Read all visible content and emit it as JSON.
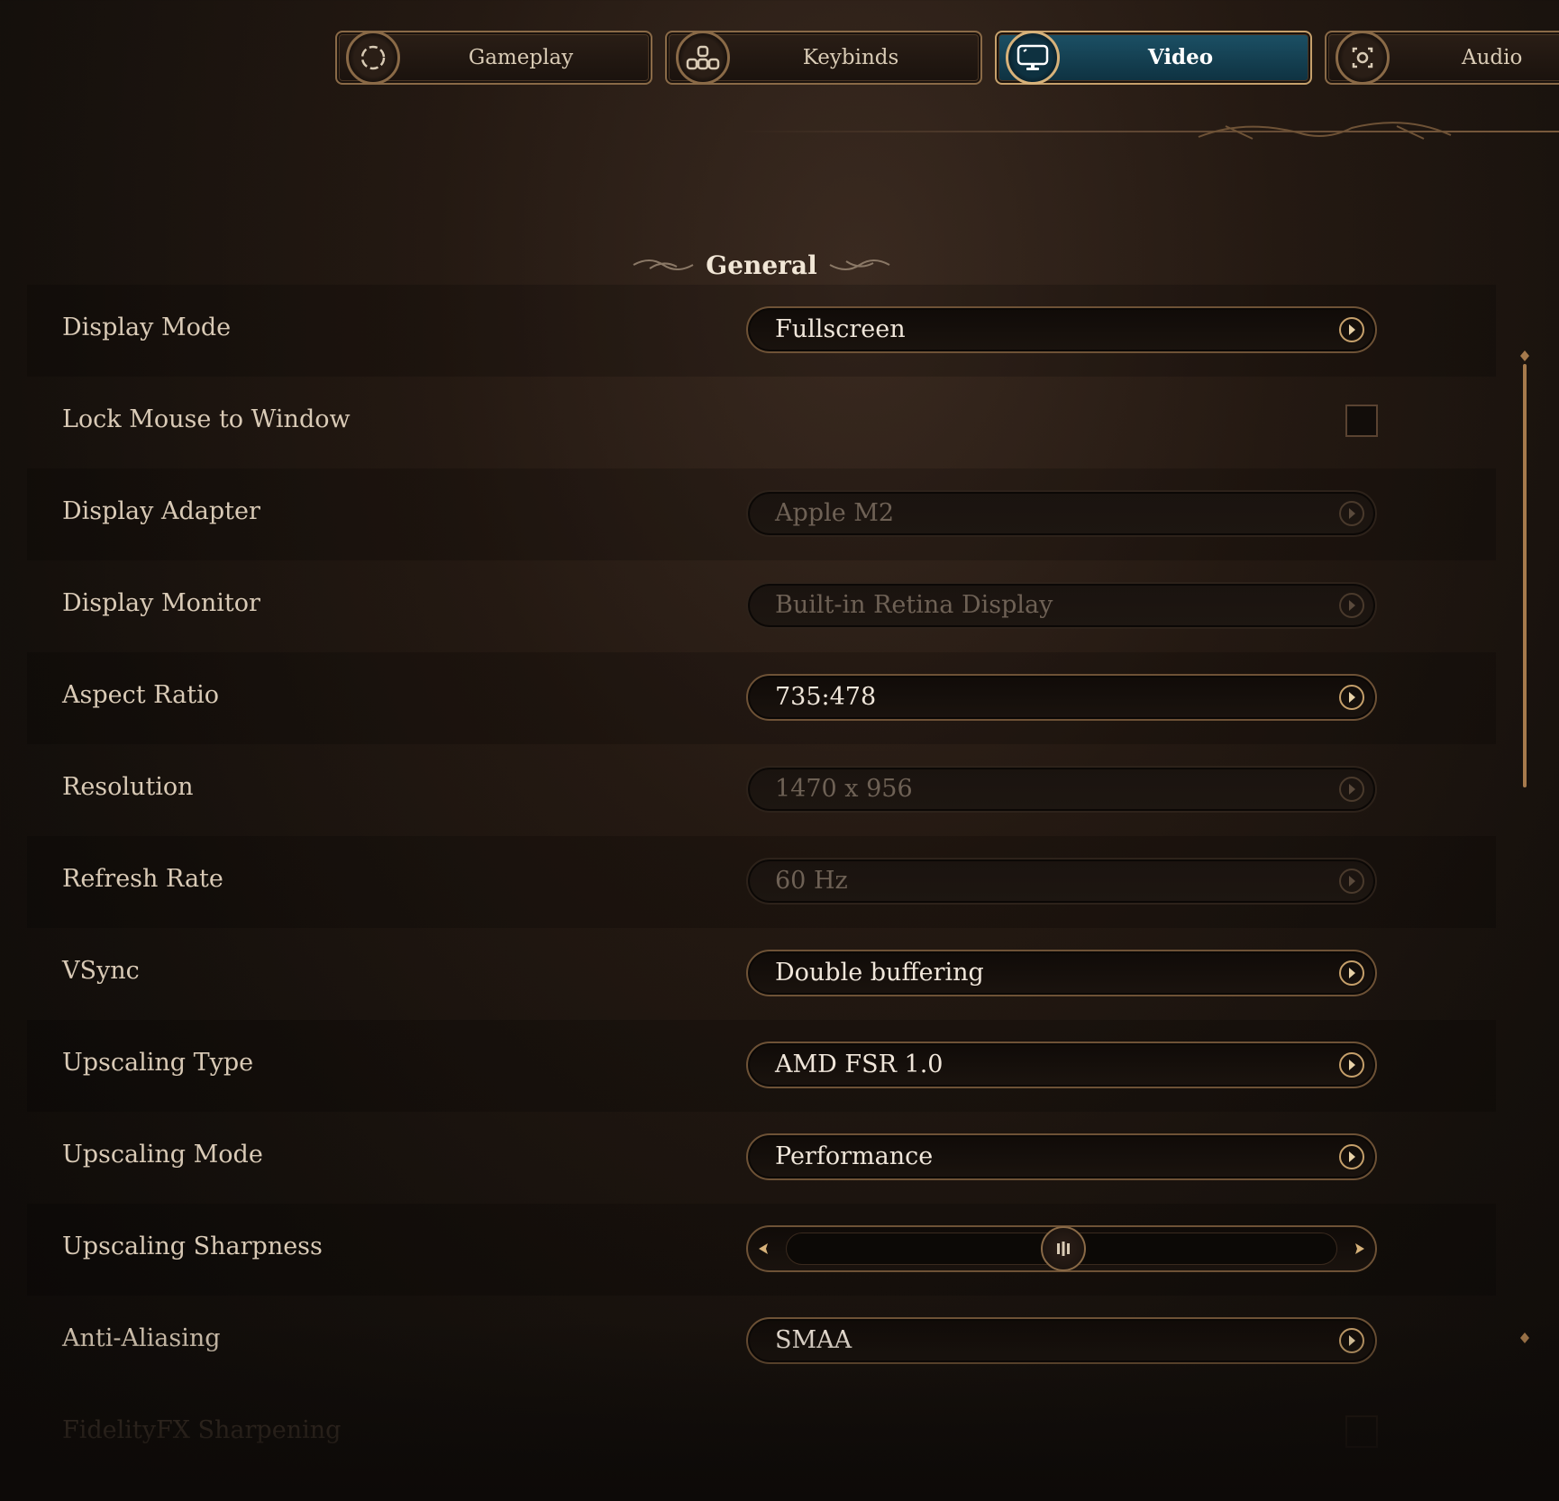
{
  "tabs": [
    {
      "label": "Gameplay",
      "icon": "gameplay-icon",
      "active": false
    },
    {
      "label": "Keybinds",
      "icon": "keybinds-icon",
      "active": false
    },
    {
      "label": "Video",
      "icon": "monitor-icon",
      "active": true
    },
    {
      "label": "Audio",
      "icon": "audio-icon",
      "active": false
    }
  ],
  "section": {
    "title": "General"
  },
  "settings": {
    "display_mode": {
      "label": "Display Mode",
      "value": "Fullscreen"
    },
    "lock_mouse": {
      "label": "Lock Mouse to Window",
      "checked": false
    },
    "display_adapter": {
      "label": "Display Adapter",
      "value": "Apple M2"
    },
    "display_monitor": {
      "label": "Display Monitor",
      "value": "Built-in Retina Display"
    },
    "aspect_ratio": {
      "label": "Aspect Ratio",
      "value": "735:478"
    },
    "resolution": {
      "label": "Resolution",
      "value": "1470 x 956"
    },
    "refresh_rate": {
      "label": "Refresh Rate",
      "value": "60 Hz"
    },
    "vsync": {
      "label": "VSync",
      "value": "Double buffering"
    },
    "upscaling_type": {
      "label": "Upscaling Type",
      "value": "AMD FSR 1.0"
    },
    "upscaling_mode": {
      "label": "Upscaling Mode",
      "value": "Performance"
    },
    "upscaling_sharpness": {
      "label": "Upscaling Sharpness",
      "level": 0.5
    },
    "anti_aliasing": {
      "label": "Anti-Aliasing",
      "value": "SMAA"
    },
    "fidelityfx_sharpening": {
      "label": "FidelityFX Sharpening",
      "checked": false
    }
  },
  "colors": {
    "accent_gold": "#c6a06b",
    "active_tab": "#1c5166",
    "background": "#15100c",
    "scroll_thumb": "#a67a4c"
  }
}
